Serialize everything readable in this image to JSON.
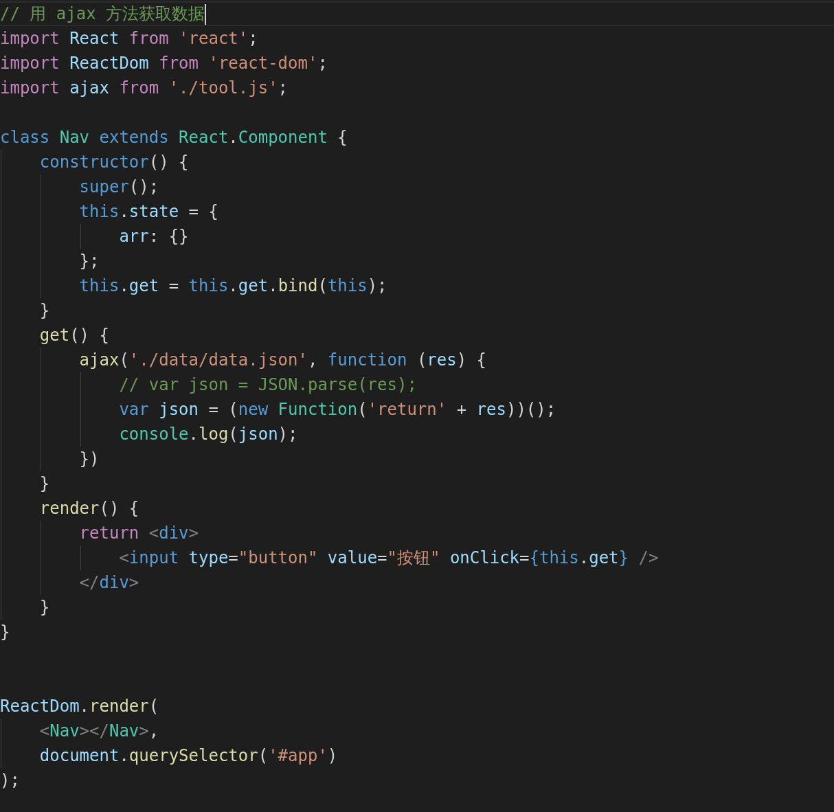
{
  "editor": {
    "lines": [
      {
        "current": true,
        "tokens": [
          {
            "kind": "comment",
            "text": "// 用 ajax 方法获取数据"
          }
        ]
      },
      {
        "current": false,
        "tokens": [
          {
            "kind": "control",
            "text": "import "
          },
          {
            "kind": "variable",
            "text": "React "
          },
          {
            "kind": "control",
            "text": "from "
          },
          {
            "kind": "string",
            "text": "'react'"
          },
          {
            "kind": "plain",
            "text": ";"
          }
        ]
      },
      {
        "current": false,
        "tokens": [
          {
            "kind": "control",
            "text": "import "
          },
          {
            "kind": "variable",
            "text": "ReactDom "
          },
          {
            "kind": "control",
            "text": "from "
          },
          {
            "kind": "string",
            "text": "'react-dom'"
          },
          {
            "kind": "plain",
            "text": ";"
          }
        ]
      },
      {
        "current": false,
        "tokens": [
          {
            "kind": "control",
            "text": "import "
          },
          {
            "kind": "variable",
            "text": "ajax "
          },
          {
            "kind": "control",
            "text": "from "
          },
          {
            "kind": "string",
            "text": "'./tool.js'"
          },
          {
            "kind": "plain",
            "text": ";"
          }
        ]
      },
      {
        "current": false
      },
      {
        "current": false,
        "tokens": [
          {
            "kind": "keyword",
            "text": "class "
          },
          {
            "kind": "type",
            "text": "Nav "
          },
          {
            "kind": "keyword",
            "text": "extends "
          },
          {
            "kind": "type",
            "text": "React"
          },
          {
            "kind": "plain",
            "text": "."
          },
          {
            "kind": "type",
            "text": "Component"
          },
          {
            "kind": "plain",
            "text": " {"
          }
        ],
        "children": [
          {
            "current": false,
            "tokens": [
              {
                "kind": "keyword",
                "text": "constructor"
              },
              {
                "kind": "plain",
                "text": "() {"
              }
            ],
            "children": [
              {
                "current": false,
                "tokens": [
                  {
                    "kind": "keyword",
                    "text": "super"
                  },
                  {
                    "kind": "plain",
                    "text": "();"
                  }
                ]
              },
              {
                "current": false,
                "tokens": [
                  {
                    "kind": "keyword",
                    "text": "this"
                  },
                  {
                    "kind": "plain",
                    "text": "."
                  },
                  {
                    "kind": "variable",
                    "text": "state"
                  },
                  {
                    "kind": "plain",
                    "text": " = {"
                  }
                ],
                "children": [
                  {
                    "current": false,
                    "tokens": [
                      {
                        "kind": "variable",
                        "text": "arr"
                      },
                      {
                        "kind": "plain",
                        "text": ": {}"
                      }
                    ]
                  }
                ]
              },
              {
                "current": false,
                "tokens": [
                  {
                    "kind": "plain",
                    "text": "};"
                  }
                ]
              },
              {
                "current": false,
                "tokens": [
                  {
                    "kind": "keyword",
                    "text": "this"
                  },
                  {
                    "kind": "plain",
                    "text": "."
                  },
                  {
                    "kind": "variable",
                    "text": "get"
                  },
                  {
                    "kind": "plain",
                    "text": " = "
                  },
                  {
                    "kind": "keyword",
                    "text": "this"
                  },
                  {
                    "kind": "plain",
                    "text": "."
                  },
                  {
                    "kind": "variable",
                    "text": "get"
                  },
                  {
                    "kind": "plain",
                    "text": "."
                  },
                  {
                    "kind": "function",
                    "text": "bind"
                  },
                  {
                    "kind": "plain",
                    "text": "("
                  },
                  {
                    "kind": "keyword",
                    "text": "this"
                  },
                  {
                    "kind": "plain",
                    "text": ");"
                  }
                ]
              }
            ]
          },
          {
            "current": false,
            "tokens": [
              {
                "kind": "plain",
                "text": "}"
              }
            ]
          },
          {
            "current": false,
            "tokens": [
              {
                "kind": "function",
                "text": "get"
              },
              {
                "kind": "plain",
                "text": "() {"
              }
            ],
            "children": [
              {
                "current": false,
                "tokens": [
                  {
                    "kind": "function",
                    "text": "ajax"
                  },
                  {
                    "kind": "plain",
                    "text": "("
                  },
                  {
                    "kind": "string",
                    "text": "'./data/data.json'"
                  },
                  {
                    "kind": "plain",
                    "text": ", "
                  },
                  {
                    "kind": "keyword",
                    "text": "function"
                  },
                  {
                    "kind": "plain",
                    "text": " ("
                  },
                  {
                    "kind": "variable",
                    "text": "res"
                  },
                  {
                    "kind": "plain",
                    "text": ") {"
                  }
                ],
                "children": [
                  {
                    "current": false,
                    "tokens": [
                      {
                        "kind": "comment",
                        "text": "// var json = JSON.parse(res);"
                      }
                    ]
                  },
                  {
                    "current": false,
                    "tokens": [
                      {
                        "kind": "keyword",
                        "text": "var "
                      },
                      {
                        "kind": "variable",
                        "text": "json"
                      },
                      {
                        "kind": "plain",
                        "text": " = ("
                      },
                      {
                        "kind": "keyword",
                        "text": "new "
                      },
                      {
                        "kind": "type",
                        "text": "Function"
                      },
                      {
                        "kind": "plain",
                        "text": "("
                      },
                      {
                        "kind": "string",
                        "text": "'return'"
                      },
                      {
                        "kind": "plain",
                        "text": " + "
                      },
                      {
                        "kind": "variable",
                        "text": "res"
                      },
                      {
                        "kind": "plain",
                        "text": "))();"
                      }
                    ]
                  },
                  {
                    "current": false,
                    "tokens": [
                      {
                        "kind": "type",
                        "text": "console"
                      },
                      {
                        "kind": "plain",
                        "text": "."
                      },
                      {
                        "kind": "function",
                        "text": "log"
                      },
                      {
                        "kind": "plain",
                        "text": "("
                      },
                      {
                        "kind": "variable",
                        "text": "json"
                      },
                      {
                        "kind": "plain",
                        "text": ");"
                      }
                    ]
                  }
                ]
              },
              {
                "current": false,
                "tokens": [
                  {
                    "kind": "plain",
                    "text": "})"
                  }
                ]
              }
            ]
          },
          {
            "current": false,
            "tokens": [
              {
                "kind": "plain",
                "text": "}"
              }
            ]
          },
          {
            "current": false,
            "tokens": [
              {
                "kind": "function",
                "text": "render"
              },
              {
                "kind": "plain",
                "text": "() {"
              }
            ],
            "children": [
              {
                "current": false,
                "tokens": [
                  {
                    "kind": "control",
                    "text": "return "
                  },
                  {
                    "kind": "bracket",
                    "text": "<"
                  },
                  {
                    "kind": "keyword",
                    "text": "div"
                  },
                  {
                    "kind": "bracket",
                    "text": ">"
                  }
                ],
                "children": [
                  {
                    "current": false,
                    "tokens": [
                      {
                        "kind": "bracket",
                        "text": "<"
                      },
                      {
                        "kind": "keyword",
                        "text": "input "
                      },
                      {
                        "kind": "variable",
                        "text": "type"
                      },
                      {
                        "kind": "plain",
                        "text": "="
                      },
                      {
                        "kind": "string",
                        "text": "\"button\" "
                      },
                      {
                        "kind": "variable",
                        "text": "value"
                      },
                      {
                        "kind": "plain",
                        "text": "="
                      },
                      {
                        "kind": "string",
                        "text": "\"按钮\" "
                      },
                      {
                        "kind": "variable",
                        "text": "onClick"
                      },
                      {
                        "kind": "plain",
                        "text": "="
                      },
                      {
                        "kind": "keyword",
                        "text": "{this"
                      },
                      {
                        "kind": "plain",
                        "text": "."
                      },
                      {
                        "kind": "variable",
                        "text": "get"
                      },
                      {
                        "kind": "keyword",
                        "text": "} "
                      },
                      {
                        "kind": "bracket",
                        "text": "/>"
                      }
                    ]
                  }
                ]
              },
              {
                "current": false,
                "tokens": [
                  {
                    "kind": "bracket",
                    "text": "</"
                  },
                  {
                    "kind": "keyword",
                    "text": "div"
                  },
                  {
                    "kind": "bracket",
                    "text": ">"
                  }
                ]
              }
            ]
          },
          {
            "current": false,
            "tokens": [
              {
                "kind": "plain",
                "text": "}"
              }
            ]
          }
        ]
      },
      {
        "current": false,
        "tokens": [
          {
            "kind": "plain",
            "text": "}"
          }
        ]
      },
      {
        "current": false
      },
      {
        "current": false
      },
      {
        "current": false,
        "tokens": [
          {
            "kind": "variable",
            "text": "ReactDom"
          },
          {
            "kind": "plain",
            "text": "."
          },
          {
            "kind": "function",
            "text": "render"
          },
          {
            "kind": "plain",
            "text": "("
          }
        ],
        "children": [
          {
            "current": false,
            "tokens": [
              {
                "kind": "bracket",
                "text": "<"
              },
              {
                "kind": "type",
                "text": "Nav"
              },
              {
                "kind": "bracket",
                "text": "></"
              },
              {
                "kind": "type",
                "text": "Nav"
              },
              {
                "kind": "bracket",
                "text": ">"
              },
              {
                "kind": "plain",
                "text": ","
              }
            ]
          },
          {
            "current": false,
            "tokens": [
              {
                "kind": "variable",
                "text": "document"
              },
              {
                "kind": "plain",
                "text": "."
              },
              {
                "kind": "function",
                "text": "querySelector"
              },
              {
                "kind": "plain",
                "text": "("
              },
              {
                "kind": "string",
                "text": "'#app'"
              },
              {
                "kind": "plain",
                "text": ")"
              }
            ]
          }
        ]
      },
      {
        "current": false,
        "tokens": [
          {
            "kind": "plain",
            "text": ");"
          }
        ]
      }
    ]
  }
}
